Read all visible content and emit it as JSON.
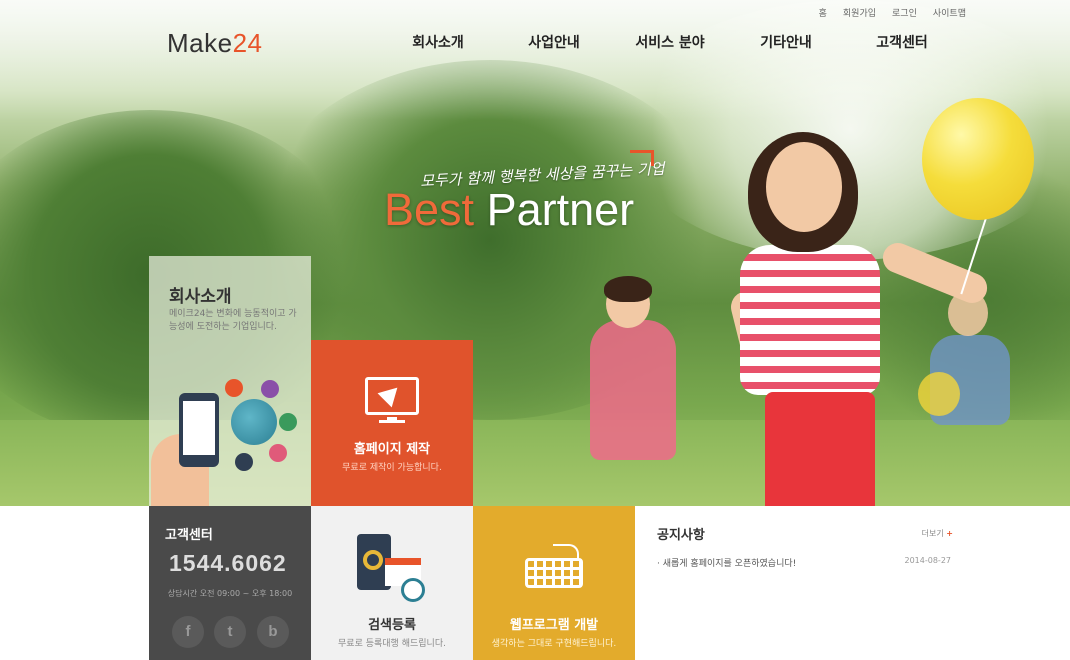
{
  "header": {
    "logo_main": "Make",
    "logo_num": "24",
    "utility": [
      "홈",
      "회원가입",
      "로그인",
      "사이트맵"
    ],
    "nav": [
      "회사소개",
      "사업안내",
      "서비스 분야",
      "기타안내",
      "고객센터"
    ]
  },
  "hero": {
    "tagline": "모두가 함께 행복한 세상을 꿈꾸는 기업",
    "headline_best": "Best",
    "headline_partner": "Partner"
  },
  "about_box": {
    "title": "회사소개",
    "desc": "메이크24는 변화에 능동적이고 가능성에 도전하는 기업입니다."
  },
  "web_box": {
    "title": "홈페이지 제작",
    "desc": "무료로 제작이 가능합니다."
  },
  "customer_center": {
    "title": "고객센터",
    "phone": "1544.6062",
    "hours": "상담시간 오전 09:00 ~ 오후 18:00",
    "social": [
      "f",
      "t",
      "b"
    ]
  },
  "search_box": {
    "title": "검색등록",
    "desc": "무료로 등록대행 해드립니다."
  },
  "dev_box": {
    "title": "웹프로그램 개발",
    "desc": "생각하는 그대로 구현해드립니다."
  },
  "notice": {
    "title": "공지사항",
    "more": "더보기",
    "plus": "+",
    "items": [
      {
        "text": "· 새롭게 홈페이지를 오픈하였습니다!",
        "date": "2014-08-27"
      }
    ]
  },
  "colors": {
    "accent": "#e8542a",
    "cs_bg": "#4a4a4a",
    "dev_bg": "#e3ab2c",
    "web_bg": "#e0532c"
  }
}
